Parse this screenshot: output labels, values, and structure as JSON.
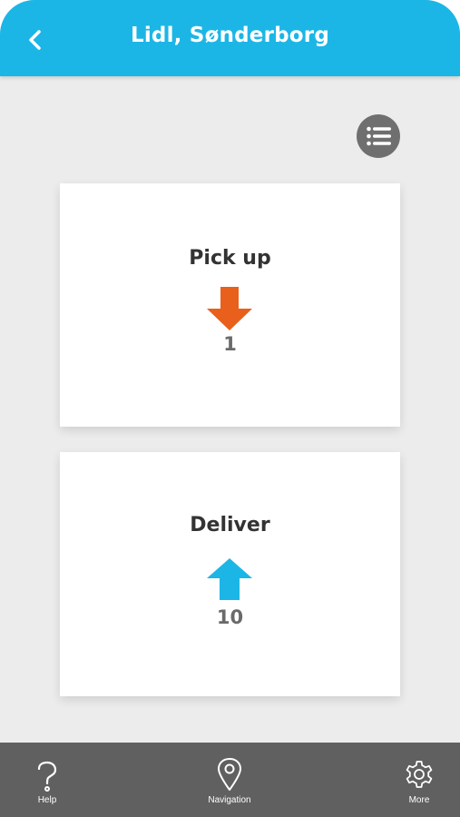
{
  "header": {
    "title": "Lidl, Sønderborg",
    "back_icon": "chevron-left-icon"
  },
  "toolbar": {
    "list_icon": "list-icon"
  },
  "cards": {
    "pickup": {
      "title": "Pick up",
      "count": "1",
      "icon": "arrow-down-icon",
      "color": "#e8601c"
    },
    "deliver": {
      "title": "Deliver",
      "count": "10",
      "icon": "arrow-up-icon",
      "color": "#1cb6e6"
    }
  },
  "bottom_nav": {
    "help": {
      "label": "Help",
      "icon": "question-mark-icon"
    },
    "navigation": {
      "label": "Navigation",
      "icon": "location-pin-icon"
    },
    "more": {
      "label": "More",
      "icon": "gear-icon"
    }
  },
  "colors": {
    "accent": "#1cb6e6",
    "background": "#ececec",
    "bottom_bar": "#606060",
    "pickup_arrow": "#e8601c"
  }
}
